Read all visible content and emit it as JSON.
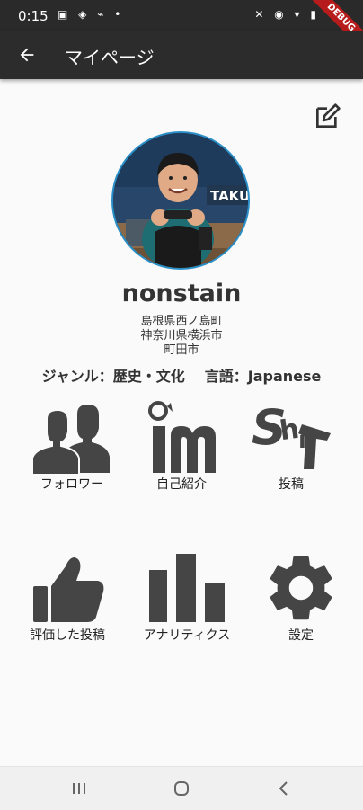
{
  "status_bar": {
    "time": "0:15",
    "left_icons": "▣ ◈ ⌁ •",
    "right_icons": "✕ ◉ ▾ ▮",
    "debug_label": "DEBUG"
  },
  "app_bar": {
    "title": "マイページ",
    "back_icon": "arrow-left-icon"
  },
  "edit_icon": "edit-pencil-icon",
  "profile": {
    "username": "nonstain",
    "locations": [
      "島根県西ノ島町",
      "神奈川県横浜市",
      "町田市"
    ],
    "genre_label": "ジャンル：歴史・文化",
    "language_label": "言語：Japanese",
    "banner_text": "TAKU"
  },
  "menu": [
    {
      "label": "フォロワー",
      "icon": "followers-icon"
    },
    {
      "label": "自己紹介",
      "icon": "im-icon"
    },
    {
      "label": "投稿",
      "icon": "shit-icon"
    },
    {
      "label": "評価した投稿",
      "icon": "thumbs-up-icon"
    },
    {
      "label": "アナリティクス",
      "icon": "bar-chart-icon"
    },
    {
      "label": "設定",
      "icon": "gear-icon"
    }
  ],
  "colors": {
    "accent": "#2a8fc7",
    "icon": "#454545",
    "appbar": "#2c2c2c"
  }
}
